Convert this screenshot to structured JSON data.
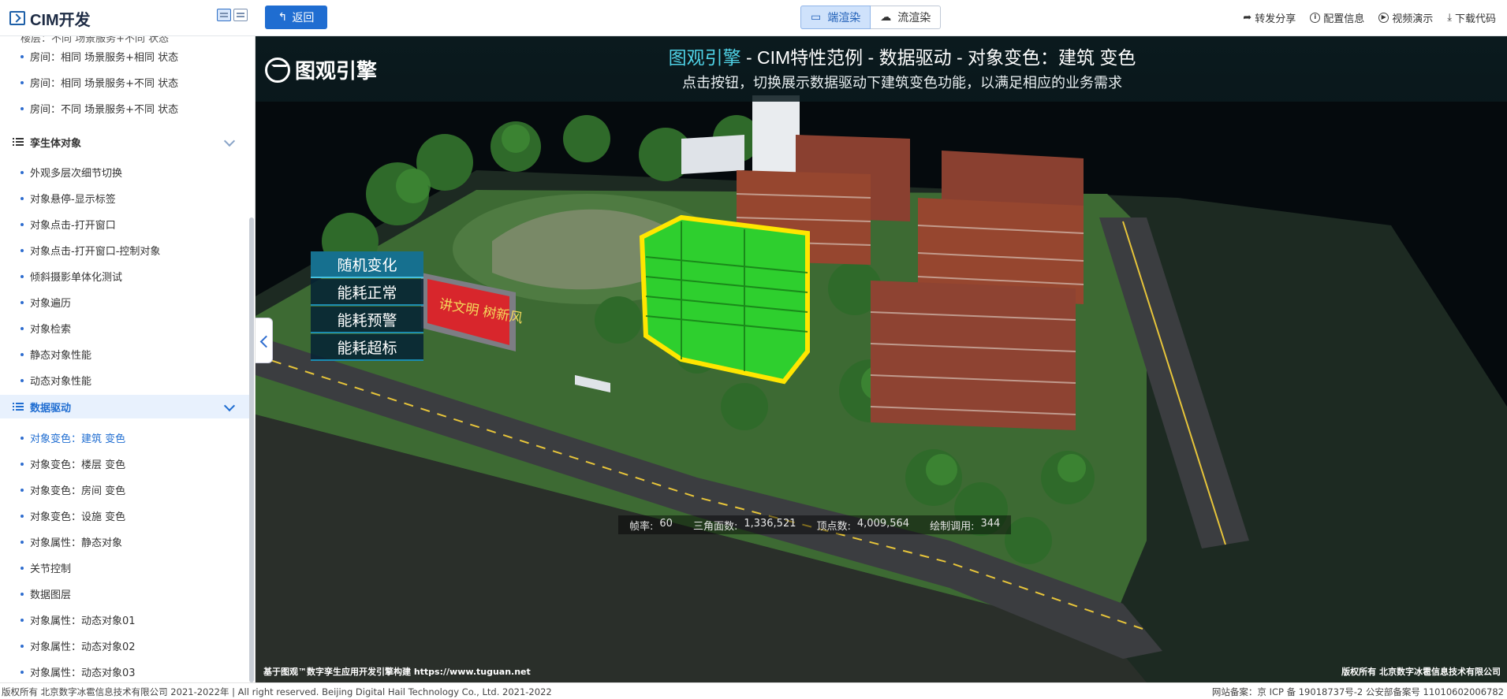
{
  "app": {
    "title": "CIM开发"
  },
  "header": {
    "back_label": "返回",
    "render_tabs": [
      "端渲染",
      "流渲染"
    ],
    "actions": [
      "转发分享",
      "配置信息",
      "视频演示",
      "下载代码"
    ]
  },
  "sidebar": {
    "cut_text": "楼层：不同 场景服务+不同 状态",
    "items_top": [
      "房间：相同 场景服务+相同 状态",
      "房间：相同 场景服务+不同 状态",
      "房间：不同 场景服务+不同 状态"
    ],
    "group1": "孪生体对象",
    "group1_items": [
      "外观多层次细节切换",
      "对象悬停-显示标签",
      "对象点击-打开窗口",
      "对象点击-打开窗口-控制对象",
      "倾斜摄影单体化测试",
      "对象遍历",
      "对象检索",
      "静态对象性能",
      "动态对象性能"
    ],
    "group2": "数据驱动",
    "group2_items": [
      "对象变色：建筑 变色",
      "对象变色：楼层 变色",
      "对象变色：房间 变色",
      "对象变色：设施 变色",
      "对象属性：静态对象",
      "关节控制",
      "数据图层",
      "对象属性：动态对象01",
      "对象属性：动态对象02",
      "对象属性：动态对象03"
    ]
  },
  "scene": {
    "engine_name": "图观引擎",
    "title_highlight": "图观引擎",
    "title_rest": " - CIM特性范例 - 数据驱动 - 对象变色：建筑 变色",
    "subtitle": "点击按钮，切换展示数据驱动下建筑变色功能，以满足相应的业务需求",
    "buttons": [
      "随机变化",
      "能耗正常",
      "能耗预警",
      "能耗超标"
    ],
    "billboard_text": "讲文明 树新风",
    "stats": {
      "fps_label": "帧率:",
      "fps": "60",
      "tri_label": "三角面数:",
      "tri": "1,336,521",
      "vert_label": "顶点数:",
      "vert": "4,009,564",
      "draw_label": "绘制调用:",
      "draw": "344"
    },
    "footer_left": "基于图观™数字孪生应用开发引擎构建 https://www.tuguan.net",
    "footer_right": "版权所有 北京数字冰雹信息技术有限公司"
  },
  "footer": {
    "left": "版权所有 北京数字冰雹信息技术有限公司 2021-2022年 | All right reserved. Beijing Digital Hail Technology Co., Ltd. 2021-2022",
    "right": "网站备案：京 ICP 备 19018737号-2 公安部备案号 11010602006782"
  },
  "colors": {
    "accent": "#1f6dd1",
    "highlight_green": "#2ecf2e",
    "outline_yellow": "#ffe600",
    "title_cyan": "#4fd2e6"
  }
}
